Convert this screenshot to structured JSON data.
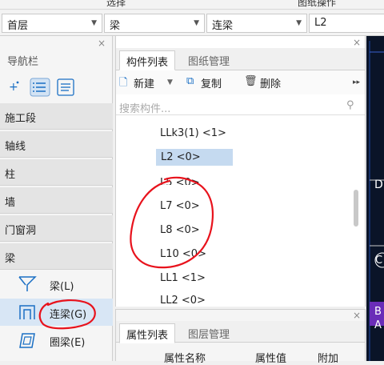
{
  "top_strip": {
    "left_text": "选择",
    "right_text": "图纸操作"
  },
  "dropdowns": [
    {
      "value": "首层"
    },
    {
      "value": "梁"
    },
    {
      "value": "连梁"
    },
    {
      "value": "L2"
    }
  ],
  "nav": {
    "title": "导航栏",
    "categories": [
      "施工段",
      "轴线",
      "柱",
      "墙",
      "门窗洞",
      "梁"
    ],
    "sub_items": [
      "梁(L)",
      "连梁(G)",
      "圈梁(E)"
    ]
  },
  "component_panel": {
    "tabs": [
      "构件列表",
      "图纸管理"
    ],
    "toolbar": {
      "new": "新建",
      "copy": "复制",
      "delete": "删除"
    },
    "search_placeholder": "搜索构件...",
    "items": [
      "LLk3(1) <1>",
      "L2 <0>",
      "L5 <0>",
      "L7 <0>",
      "L8 <0>",
      "L10 <0>",
      "LL1 <1>",
      "LL2 <0>"
    ],
    "selected": "L2 <0>"
  },
  "property_panel": {
    "tabs": [
      "属性列表",
      "图层管理"
    ],
    "columns": [
      "属性名称",
      "属性值",
      "附加"
    ]
  },
  "colors": {
    "accent": "#1a6fc4",
    "annotation_red": "#e8121c",
    "canvas": "#0a1428"
  }
}
